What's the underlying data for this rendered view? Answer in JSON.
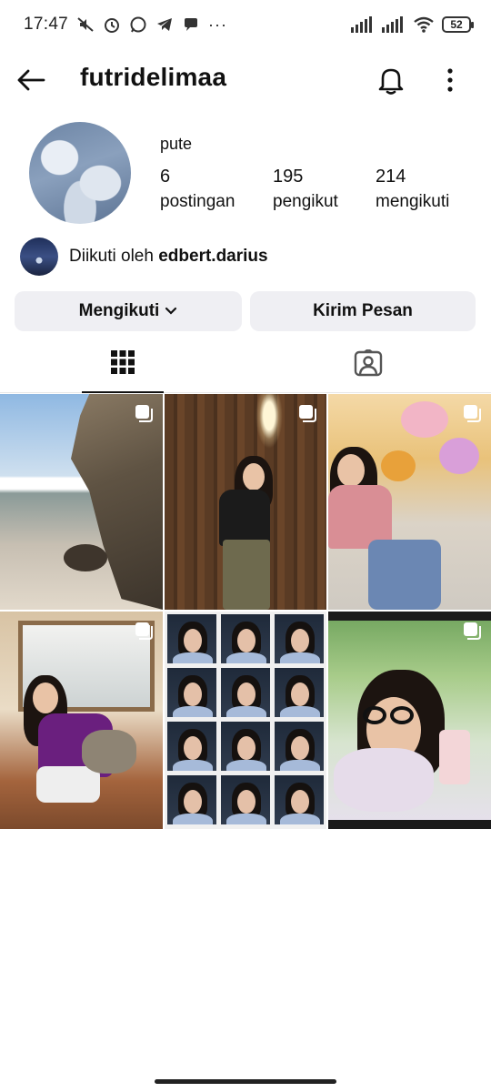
{
  "status_bar": {
    "time": "17:47",
    "more": "···",
    "battery": "52"
  },
  "header": {
    "username": "futridelimaa"
  },
  "profile": {
    "display_name": "pute",
    "stats": [
      {
        "value": "6",
        "label": "postingan"
      },
      {
        "value": "195",
        "label": "pengikut"
      },
      {
        "value": "214",
        "label": "mengikuti"
      }
    ],
    "followed_by_prefix": "Diikuti oleh",
    "followed_by_user": "edbert.darius"
  },
  "actions": {
    "following_label": "Mengikuti",
    "message_label": "Kirim Pesan"
  },
  "tabs": [
    {
      "icon": "grid-icon",
      "active": true
    },
    {
      "icon": "tagged-person-icon",
      "active": false
    }
  ],
  "posts": [
    {
      "subject": "beach-rock-photo",
      "multiple": true
    },
    {
      "subject": "girl-wooden-wall-photo",
      "multiple": true
    },
    {
      "subject": "girl-flowers-sofa-photo",
      "multiple": true
    },
    {
      "subject": "girl-with-cat-photo",
      "multiple": true
    },
    {
      "subject": "photo-booth-collage",
      "multiple": false
    },
    {
      "subject": "mirror-selfie-photo",
      "multiple": true
    }
  ],
  "colors": {
    "button_bg": "#efeff3",
    "text": "#111111",
    "active_tab": "#111111"
  }
}
